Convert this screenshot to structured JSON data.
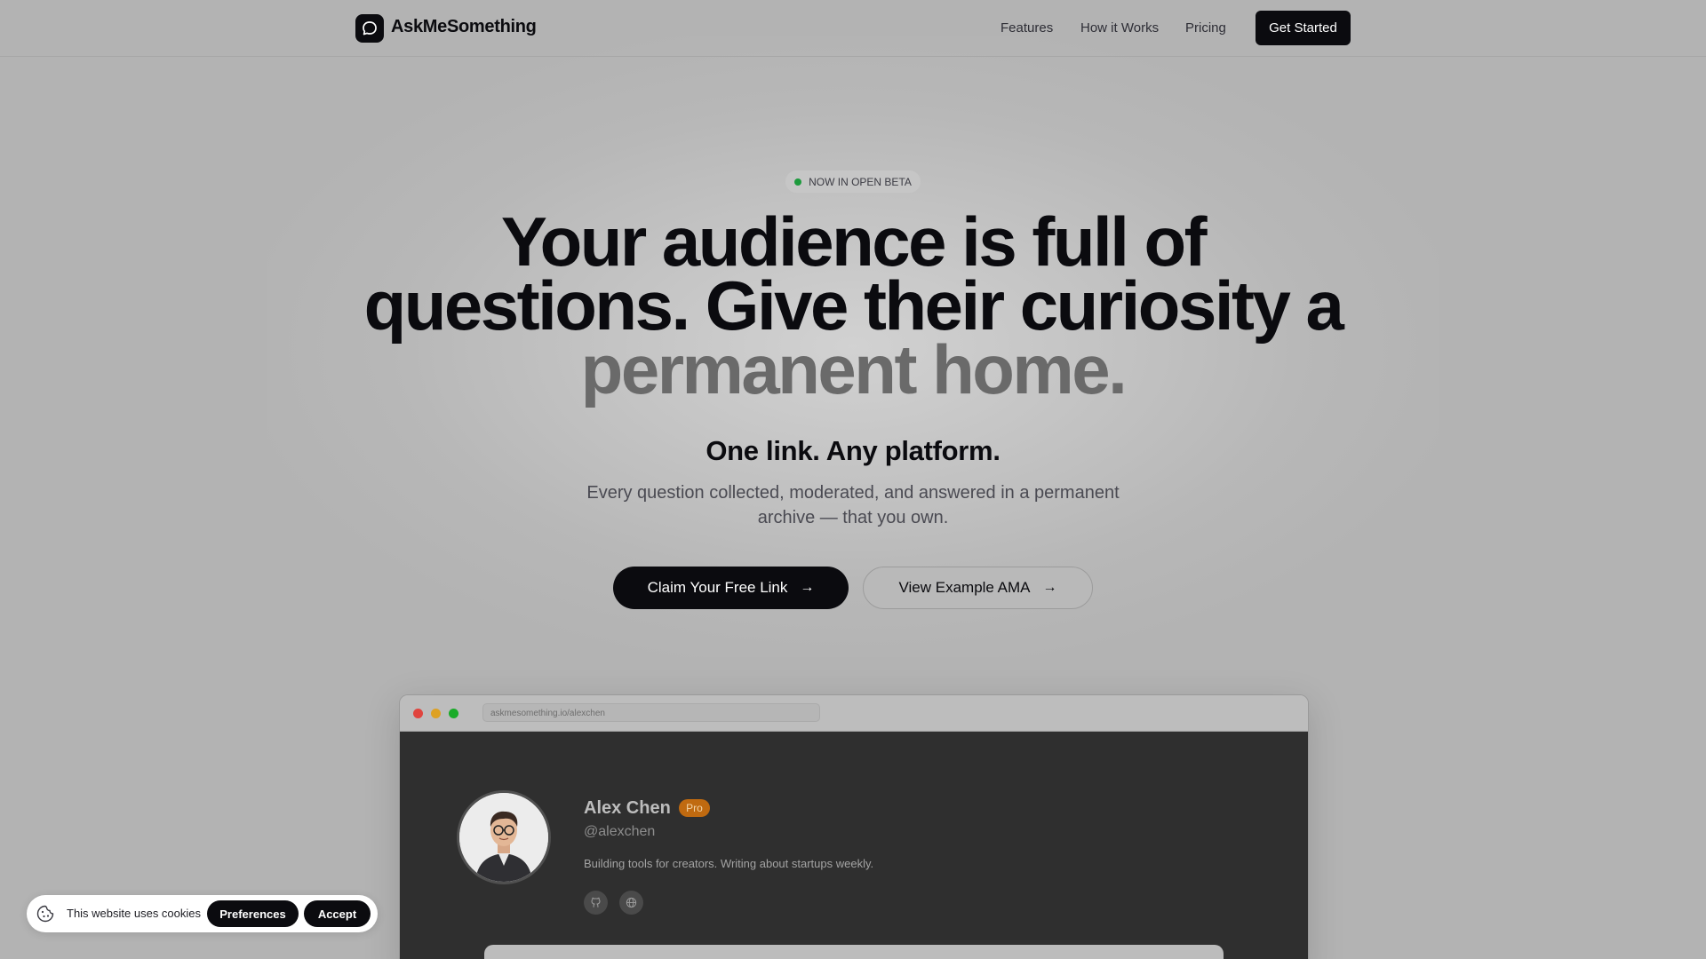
{
  "nav": {
    "brand": "AskMeSomething",
    "links": [
      "Features",
      "How it Works",
      "Pricing"
    ],
    "cta": "Get Started"
  },
  "hero": {
    "badge": "NOW IN OPEN BETA",
    "headline_line1": "Your audience is full of",
    "headline_line2": "questions. Give their curiosity a",
    "headline_line3": "permanent home.",
    "subhead": "One link. Any platform.",
    "description": "Every question collected, moderated, and answered in a permanent archive — that you own.",
    "primary_cta": "Claim Your Free Link",
    "secondary_cta": "View Example AMA",
    "arrow": "→"
  },
  "preview": {
    "url": "askmesomething.io/alexchen",
    "name": "Alex Chen",
    "badge": "Pro",
    "handle": "@alexchen",
    "bio": "Building tools for creators. Writing about startups weekly.",
    "social_icons": [
      "github-icon",
      "globe-icon"
    ]
  },
  "cookie": {
    "text": "This website uses cookies",
    "preferences": "Preferences",
    "accept": "Accept"
  },
  "colors": {
    "background": "#b3b3b3",
    "ink": "#0b0b0f",
    "muted_headline": "#6a6a6a",
    "beta_dot": "#1d9a3d",
    "pro_badge": "#c06a10",
    "window_close": "#e0443e",
    "window_min": "#dea123",
    "window_max": "#1aab29"
  }
}
